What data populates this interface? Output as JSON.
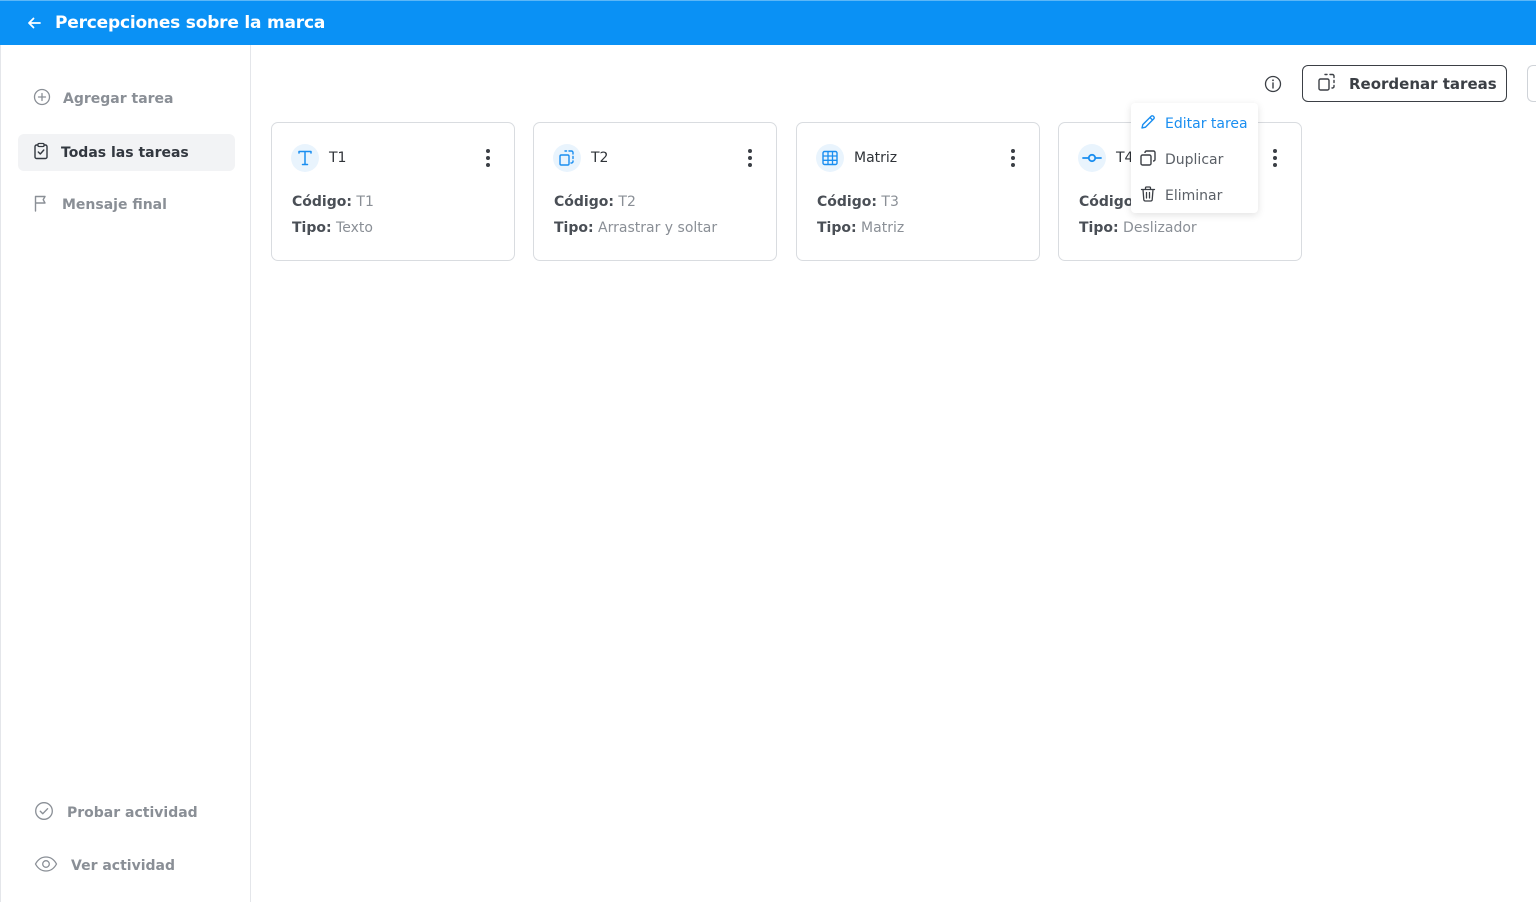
{
  "header": {
    "title": "Percepciones sobre la marca"
  },
  "sidebar": {
    "items": [
      {
        "label": "Agregar tarea"
      },
      {
        "label": "Todas las tareas"
      },
      {
        "label": "Mensaje final"
      }
    ],
    "bottom": [
      {
        "label": "Probar actividad"
      },
      {
        "label": "Ver actividad"
      }
    ]
  },
  "toolbar": {
    "reorder_label": "Reordenar tareas"
  },
  "cards": [
    {
      "name": "T1",
      "code_label": "Código:",
      "code": "T1",
      "type_label": "Tipo:",
      "type": "Texto",
      "icon": "text-icon"
    },
    {
      "name": "T2",
      "code_label": "Código:",
      "code": "T2",
      "type_label": "Tipo:",
      "type": "Arrastrar y soltar",
      "icon": "drag-drop-icon"
    },
    {
      "name": "Matriz",
      "code_label": "Código:",
      "code": "T3",
      "type_label": "Tipo:",
      "type": "Matriz",
      "icon": "table-icon"
    },
    {
      "name": "T4",
      "code_label": "Código",
      "code": "",
      "type_label": "Tipo:",
      "type": "Deslizador",
      "icon": "slider-icon"
    }
  ],
  "context_menu": {
    "edit": "Editar tarea",
    "duplicate": "Duplicar",
    "delete": "Eliminar"
  },
  "colors": {
    "accent": "#0a91f5",
    "link": "#1a8ef0"
  }
}
